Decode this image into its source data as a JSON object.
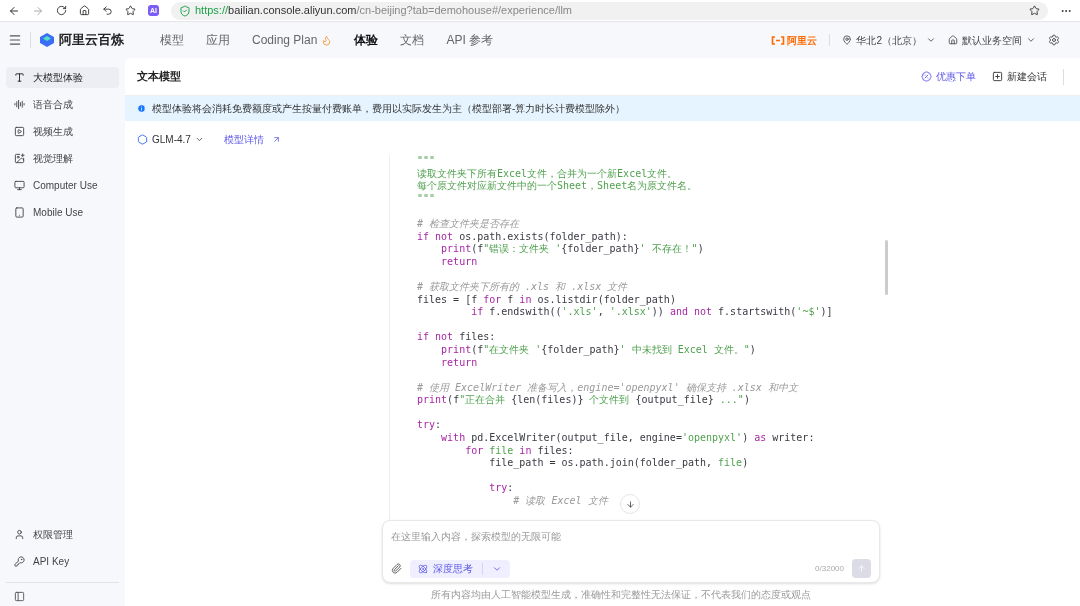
{
  "browser": {
    "url_scheme": "https://",
    "url_host": "bailian.console.aliyun.com",
    "url_path": "/cn-beijing?tab=demohouse#/experience/llm",
    "ext_label": "AI"
  },
  "header": {
    "brand": "阿里云百炼",
    "nav": [
      {
        "label": "模型",
        "selected": false,
        "hot": false
      },
      {
        "label": "应用",
        "selected": false,
        "hot": false
      },
      {
        "label": "Coding Plan",
        "selected": false,
        "hot": true
      },
      {
        "label": "体验",
        "selected": true,
        "hot": false
      },
      {
        "label": "文档",
        "selected": false,
        "hot": false
      },
      {
        "label": "API 参考",
        "selected": false,
        "hot": false
      }
    ],
    "cloud_logo": "阿里云",
    "region": "华北2（北京）",
    "workspace": "默认业务空间"
  },
  "sidebar": {
    "items": [
      {
        "kind": "text",
        "label": "大模型体验",
        "selected": true
      },
      {
        "kind": "audio",
        "label": "语音合成",
        "selected": false
      },
      {
        "kind": "video",
        "label": "视频生成",
        "selected": false
      },
      {
        "kind": "vision",
        "label": "视觉理解",
        "selected": false
      },
      {
        "kind": "computer",
        "label": "Computer Use",
        "selected": false
      },
      {
        "kind": "mobile",
        "label": "Mobile Use",
        "selected": false
      }
    ],
    "bottom_items": [
      {
        "kind": "user",
        "label": "权限管理"
      },
      {
        "kind": "key",
        "label": "API Key"
      }
    ]
  },
  "main": {
    "title": "文本模型",
    "actions": [
      {
        "kind": "discount",
        "label": "优惠下单"
      },
      {
        "kind": "new",
        "label": "新建会话"
      }
    ],
    "notice": "模型体验将会消耗免费额度或产生按量付费账单，费用以实际发生为主（模型部署-算力时长计费模型除外）",
    "model": "GLM-4.7",
    "model_link": "模型详情",
    "code": [
      {
        "kind": "code",
        "tokens": [
          {
            "text": "\"\"\"",
            "kind": "string"
          }
        ]
      },
      {
        "kind": "code",
        "tokens": [
          {
            "text": "读取文件夹下所有Excel文件，合并为一个新Excel文件。",
            "kind": "string"
          }
        ]
      },
      {
        "kind": "code",
        "tokens": [
          {
            "text": "每个原文件对应新文件中的一个Sheet，Sheet名为原文件名。",
            "kind": "string"
          }
        ]
      },
      {
        "kind": "code",
        "tokens": [
          {
            "text": "\"\"\"",
            "kind": "string"
          }
        ]
      },
      {
        "kind": "blank"
      },
      {
        "kind": "code",
        "tokens": [
          {
            "text": "# 检查文件夹是否存在",
            "kind": "comment"
          }
        ]
      },
      {
        "kind": "code",
        "tokens": [
          {
            "text": "if not",
            "kind": "keyword"
          },
          {
            "text": " os.path.exists(folder_path):",
            "kind": "plain"
          }
        ]
      },
      {
        "kind": "code",
        "tokens": [
          {
            "text": "    print",
            "kind": "keyword"
          },
          {
            "text": "(f",
            "kind": "plain"
          },
          {
            "text": "\"错误：文件夹 '",
            "kind": "string"
          },
          {
            "text": "{folder_path}",
            "kind": "plain"
          },
          {
            "text": "' 不存在！\"",
            "kind": "string"
          },
          {
            "text": ")",
            "kind": "plain"
          }
        ]
      },
      {
        "kind": "code",
        "tokens": [
          {
            "text": "    return",
            "kind": "keyword"
          }
        ]
      },
      {
        "kind": "blank"
      },
      {
        "kind": "code",
        "tokens": [
          {
            "text": "# 获取文件夹下所有的 .xls 和 .xlsx 文件",
            "kind": "comment"
          }
        ]
      },
      {
        "kind": "code",
        "tokens": [
          {
            "text": "files = [f ",
            "kind": "plain"
          },
          {
            "text": "for",
            "kind": "keyword"
          },
          {
            "text": " f ",
            "kind": "plain"
          },
          {
            "text": "in",
            "kind": "keyword"
          },
          {
            "text": " os.listdir(folder_path)",
            "kind": "plain"
          }
        ]
      },
      {
        "kind": "code",
        "tokens": [
          {
            "text": "         if",
            "kind": "keyword"
          },
          {
            "text": " f.endswith((",
            "kind": "plain"
          },
          {
            "text": "'.xls'",
            "kind": "string"
          },
          {
            "text": ", ",
            "kind": "plain"
          },
          {
            "text": "'.xlsx'",
            "kind": "string"
          },
          {
            "text": ")) ",
            "kind": "plain"
          },
          {
            "text": "and not",
            "kind": "keyword"
          },
          {
            "text": " f.startswith(",
            "kind": "plain"
          },
          {
            "text": "'~$'",
            "kind": "string"
          },
          {
            "text": ")]",
            "kind": "plain"
          }
        ]
      },
      {
        "kind": "blank"
      },
      {
        "kind": "code",
        "tokens": [
          {
            "text": "if not",
            "kind": "keyword"
          },
          {
            "text": " files:",
            "kind": "plain"
          }
        ]
      },
      {
        "kind": "code",
        "tokens": [
          {
            "text": "    print",
            "kind": "keyword"
          },
          {
            "text": "(f",
            "kind": "plain"
          },
          {
            "text": "\"在文件夹 '",
            "kind": "string"
          },
          {
            "text": "{folder_path}",
            "kind": "plain"
          },
          {
            "text": "' 中未找到 Excel 文件。\"",
            "kind": "string"
          },
          {
            "text": ")",
            "kind": "plain"
          }
        ]
      },
      {
        "kind": "code",
        "tokens": [
          {
            "text": "    return",
            "kind": "keyword"
          }
        ]
      },
      {
        "kind": "blank"
      },
      {
        "kind": "code",
        "tokens": [
          {
            "text": "# 使用 ExcelWriter 准备写入，engine='openpyxl' 确保支持 .xlsx 和中文",
            "kind": "comment"
          }
        ]
      },
      {
        "kind": "code",
        "tokens": [
          {
            "text": "print",
            "kind": "keyword"
          },
          {
            "text": "(f",
            "kind": "plain"
          },
          {
            "text": "\"正在合并 ",
            "kind": "string"
          },
          {
            "text": "{len(files)}",
            "kind": "plain"
          },
          {
            "text": " 个文件到 ",
            "kind": "string"
          },
          {
            "text": "{output_file}",
            "kind": "plain"
          },
          {
            "text": " ...\"",
            "kind": "string"
          },
          {
            "text": ")",
            "kind": "plain"
          }
        ]
      },
      {
        "kind": "blank"
      },
      {
        "kind": "code",
        "tokens": [
          {
            "text": "try",
            "kind": "keyword"
          },
          {
            "text": ":",
            "kind": "plain"
          }
        ]
      },
      {
        "kind": "code",
        "tokens": [
          {
            "text": "    with",
            "kind": "keyword"
          },
          {
            "text": " pd.ExcelWriter(output_file, engine=",
            "kind": "plain"
          },
          {
            "text": "'openpyxl'",
            "kind": "string"
          },
          {
            "text": ") ",
            "kind": "plain"
          },
          {
            "text": "as",
            "kind": "keyword"
          },
          {
            "text": " writer:",
            "kind": "plain"
          }
        ]
      },
      {
        "kind": "code",
        "tokens": [
          {
            "text": "        for ",
            "kind": "keyword"
          },
          {
            "text": "file",
            "kind": "string"
          },
          {
            "text": " in",
            "kind": "keyword"
          },
          {
            "text": " files:",
            "kind": "plain"
          }
        ]
      },
      {
        "kind": "code",
        "tokens": [
          {
            "text": "            file_path = os.path.join(folder_path, ",
            "kind": "plain"
          },
          {
            "text": "file",
            "kind": "string"
          },
          {
            "text": ")",
            "kind": "plain"
          }
        ]
      },
      {
        "kind": "blank"
      },
      {
        "kind": "code",
        "tokens": [
          {
            "text": "            try",
            "kind": "keyword"
          },
          {
            "text": ":",
            "kind": "plain"
          }
        ]
      },
      {
        "kind": "code",
        "tokens": [
          {
            "text": "                # 读取 Excel 文件",
            "kind": "comment"
          }
        ]
      }
    ],
    "input": {
      "placeholder": "在这里输入内容，探索模型的无限可能",
      "mode": "深度思考",
      "counter": "0/32000"
    },
    "disclaimer": "所有内容均由人工智能模型生成，准确性和完整性无法保证，不代表我们的态度或观点"
  }
}
